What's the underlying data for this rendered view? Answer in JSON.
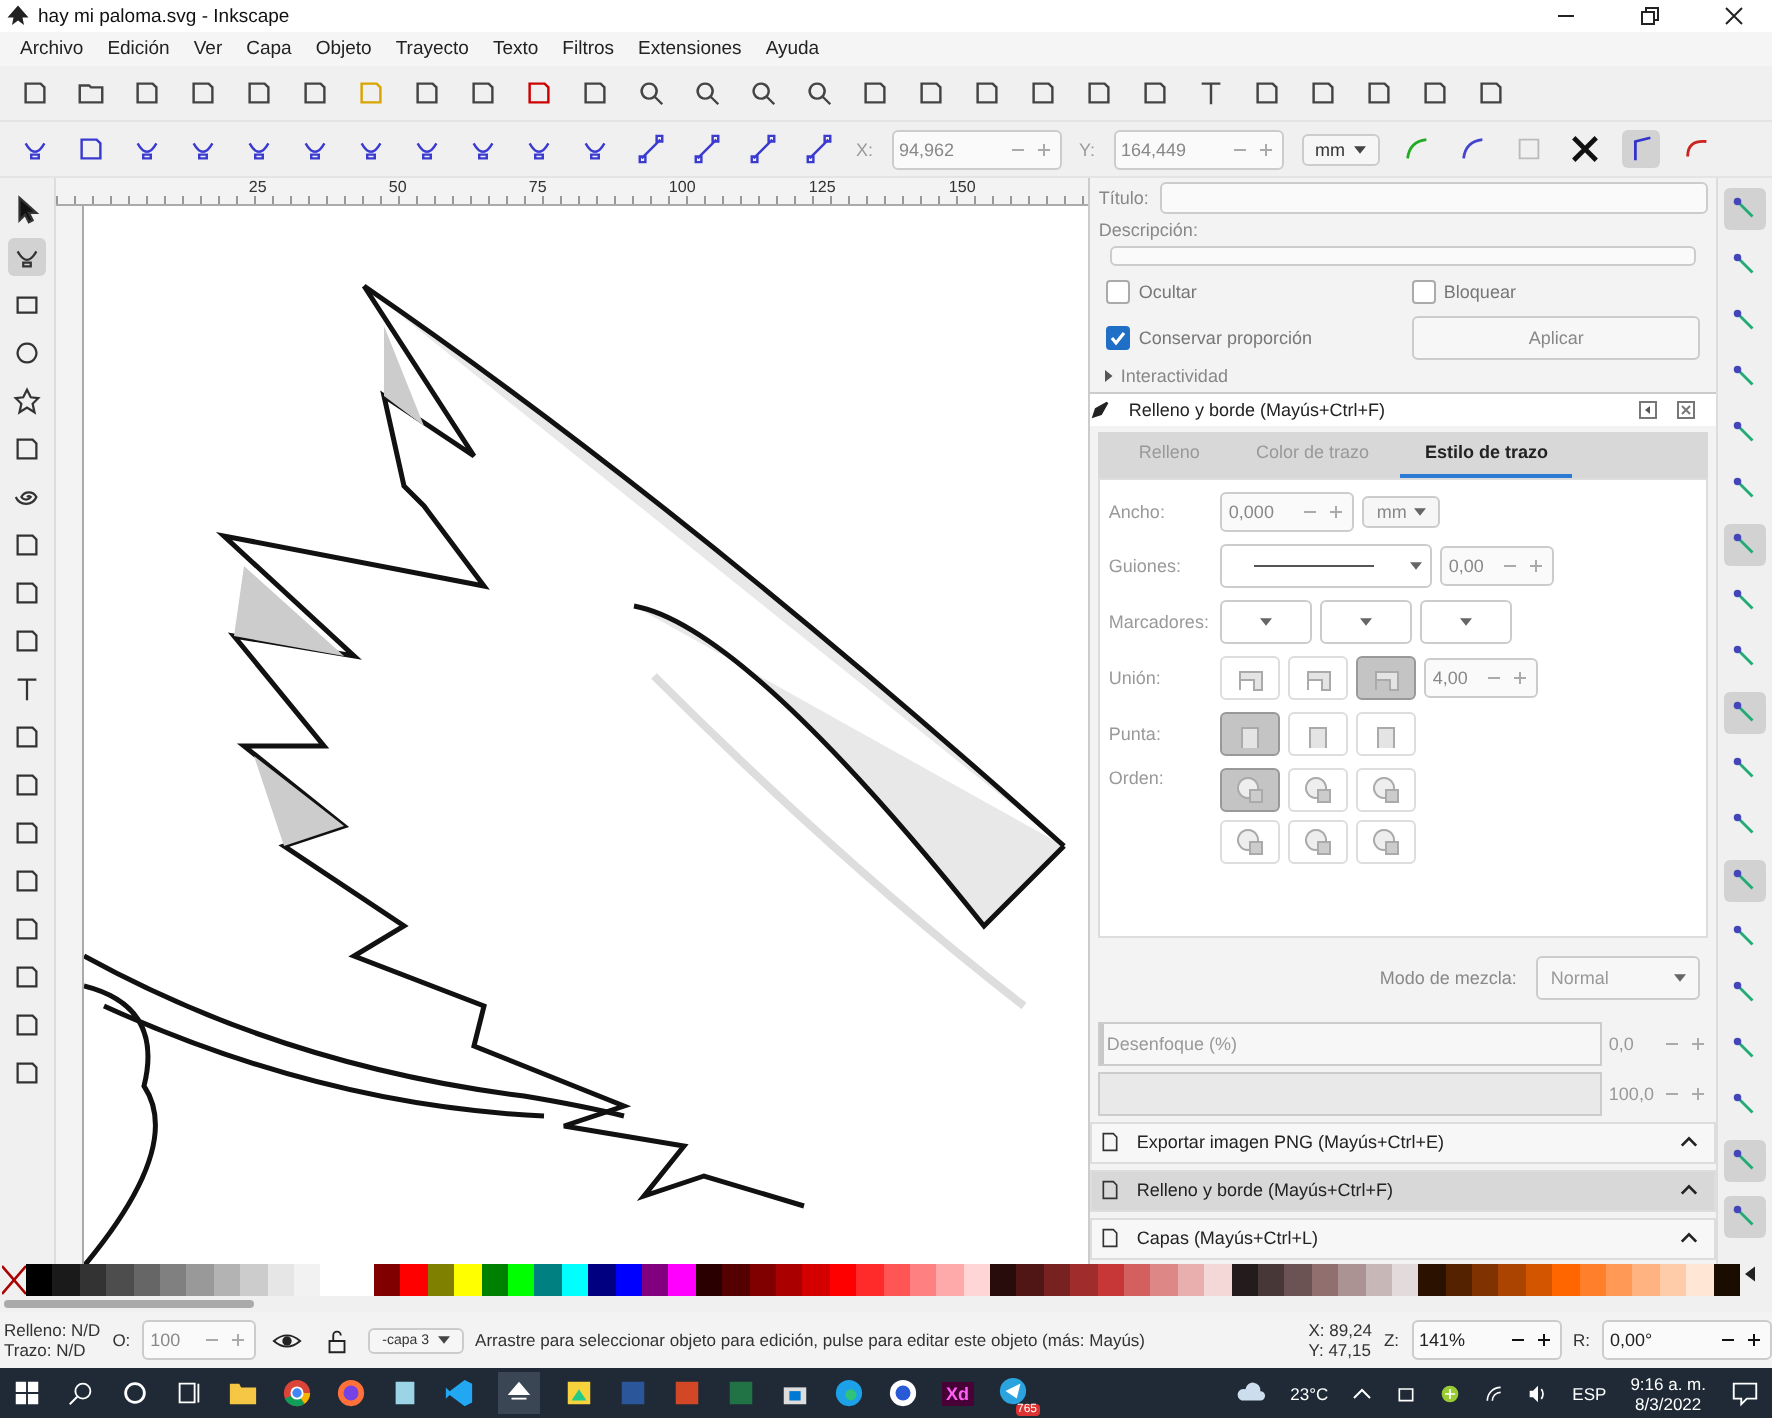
{
  "window": {
    "title": "hay mi paloma.svg - Inkscape"
  },
  "menu": [
    "Archivo",
    "Edición",
    "Ver",
    "Capa",
    "Objeto",
    "Trayecto",
    "Texto",
    "Filtros",
    "Extensiones",
    "Ayuda"
  ],
  "node_toolbar": {
    "x_label": "X:",
    "x_value": "94,962",
    "y_label": "Y:",
    "y_value": "164,449",
    "unit": "mm"
  },
  "ruler": [
    "25",
    "50",
    "75",
    "100",
    "125",
    "150"
  ],
  "object_properties": {
    "title_label": "Título:",
    "description_label": "Descripción:",
    "checkboxes": [
      {
        "label": "Ocultar",
        "checked": false
      },
      {
        "label": "Bloquear",
        "checked": false
      },
      {
        "label": "Conservar proporción",
        "checked": true
      }
    ],
    "apply_button": "Aplicar",
    "interactivity": {
      "label": "Interactividad",
      "expanded": false
    }
  },
  "fill_stroke": {
    "title": "Relleno y borde (Mayús+Ctrl+F)",
    "tabs": [
      {
        "label": "Relleno",
        "selected": false
      },
      {
        "label": "Color de trazo",
        "selected": false
      },
      {
        "label": "Estilo de trazo",
        "selected": true
      }
    ],
    "width": {
      "label": "Ancho:",
      "value": "0,000",
      "unit": "mm"
    },
    "dashes": {
      "label": "Guiones:",
      "value": "0,00"
    },
    "markers_label": "Marcadores:",
    "join": {
      "label": "Unión:",
      "value": "4,00",
      "buttons": [
        {
          "selected": false
        },
        {
          "selected": false
        },
        {
          "selected": true
        }
      ]
    },
    "cap": {
      "label": "Punta:",
      "buttons": [
        {
          "selected": true
        },
        {
          "selected": false
        },
        {
          "selected": false
        }
      ]
    },
    "order": {
      "label": "Orden:",
      "buttons": [
        {
          "selected": true
        },
        {
          "selected": false
        },
        {
          "selected": false
        },
        {
          "selected": false
        },
        {
          "selected": false
        },
        {
          "selected": false
        }
      ]
    },
    "blend_label": "Modo de mezcla:",
    "blend_value": "Normal",
    "blur": {
      "label": "Desenfoque (%)",
      "value": "0,0",
      "level": 0
    },
    "opacity": {
      "value": "100,0",
      "level": 1
    }
  },
  "docked_panels": [
    {
      "label": "Exportar imagen PNG (Mayús+Ctrl+E)",
      "selected": false
    },
    {
      "label": "Relleno y borde (Mayús+Ctrl+F)",
      "selected": true
    },
    {
      "label": "Capas (Mayús+Ctrl+L)",
      "selected": false
    }
  ],
  "snap_bar": [
    {
      "on": true
    },
    {
      "on": false
    },
    {
      "on": false
    },
    {
      "on": false
    },
    {
      "on": false
    },
    {
      "on": false
    },
    {
      "on": true
    },
    {
      "on": false
    },
    {
      "on": false
    },
    {
      "on": true
    },
    {
      "on": false
    },
    {
      "on": false
    },
    {
      "on": true
    },
    {
      "on": false
    },
    {
      "on": false
    },
    {
      "on": false
    },
    {
      "on": false
    },
    {
      "on": true
    },
    {
      "on": true
    }
  ],
  "palette": [
    {
      "color": "#000000"
    },
    {
      "color": "#1a1a1a"
    },
    {
      "color": "#333333"
    },
    {
      "color": "#4d4d4d"
    },
    {
      "color": "#666666"
    },
    {
      "color": "#808080"
    },
    {
      "color": "#999999"
    },
    {
      "color": "#b3b3b3"
    },
    {
      "color": "#cccccc"
    },
    {
      "color": "#e6e6e6"
    },
    {
      "color": "#f2f2f2"
    },
    {
      "color": "#ffffff"
    },
    {
      "color": "#ffffff"
    },
    {
      "color": "#800000"
    },
    {
      "color": "#ff0000"
    },
    {
      "color": "#808000"
    },
    {
      "color": "#ffff00"
    },
    {
      "color": "#008000"
    },
    {
      "color": "#00ff00"
    },
    {
      "color": "#008080"
    },
    {
      "color": "#00ffff"
    },
    {
      "color": "#000080"
    },
    {
      "color": "#0000ff"
    },
    {
      "color": "#800080"
    },
    {
      "color": "#ff00ff"
    },
    {
      "color": "#2b0000"
    },
    {
      "color": "#550000"
    },
    {
      "color": "#800000"
    },
    {
      "color": "#aa0000"
    },
    {
      "color": "#d40000"
    },
    {
      "color": "#ff0000"
    },
    {
      "color": "#ff2a2a"
    },
    {
      "color": "#ff5555"
    },
    {
      "color": "#ff8080"
    },
    {
      "color": "#ffaaaa"
    },
    {
      "color": "#ffd5d5"
    },
    {
      "color": "#280b0b"
    },
    {
      "color": "#501616"
    },
    {
      "color": "#782121"
    },
    {
      "color": "#a02c2c"
    },
    {
      "color": "#c83737"
    },
    {
      "color": "#d35f5f"
    },
    {
      "color": "#de8787"
    },
    {
      "color": "#e9afaf"
    },
    {
      "color": "#f4d7d7"
    },
    {
      "color": "#241c1c"
    },
    {
      "color": "#483737"
    },
    {
      "color": "#6c5353"
    },
    {
      "color": "#916f6f"
    },
    {
      "color": "#ac9393"
    },
    {
      "color": "#c8b7b7"
    },
    {
      "color": "#e3dbdb"
    },
    {
      "color": "#2b1100"
    },
    {
      "color": "#552200"
    },
    {
      "color": "#803300"
    },
    {
      "color": "#aa4400"
    },
    {
      "color": "#d45500"
    },
    {
      "color": "#ff6600"
    },
    {
      "color": "#ff7f2a"
    },
    {
      "color": "#ff9955"
    },
    {
      "color": "#ffb380"
    },
    {
      "color": "#ffccaa"
    },
    {
      "color": "#ffe6d5"
    },
    {
      "color": "#1a0d00"
    }
  ],
  "status": {
    "fill_label": "Relleno:",
    "fill_value": "N/D",
    "stroke_label": "Trazo:",
    "stroke_value": "N/D",
    "opacity_label": "O:",
    "opacity_value": "100",
    "layer": "-capa 3",
    "message": "Arrastre para seleccionar objeto para edición, pulse para editar este objeto (más: Mayús)",
    "x_label": "X:",
    "x_value": "89,24",
    "y_label": "Y:",
    "y_value": "47,15",
    "zoom_label": "Z:",
    "zoom_value": "141%",
    "rotate_label": "R:",
    "rotate_value": "0,00°"
  },
  "taskbar": {
    "xd_label": "Xd",
    "telegram_badge": "765",
    "temperature": "23°C",
    "language": "ESP",
    "time": "9:16 a. m.",
    "date": "8/3/2022"
  }
}
